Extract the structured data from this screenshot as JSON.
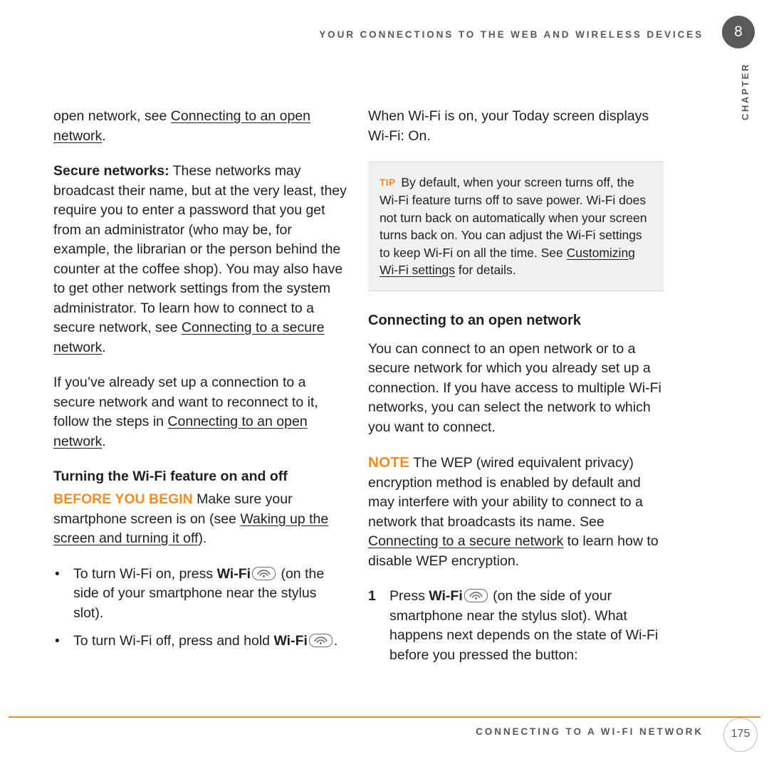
{
  "header": {
    "title": "YOUR CONNECTIONS TO THE WEB AND WIRELESS DEVICES",
    "chapter_number": "8",
    "chapter_label": "CHAPTER"
  },
  "footer": {
    "title": "CONNECTING TO A WI-FI NETWORK",
    "page_number": "175",
    "accent_color": "#f68b1f"
  },
  "left_column": {
    "para_continue_1": "open network, see ",
    "para_continue_1_link": "Connecting to an open network",
    "para_continue_1_end": ".",
    "secure_label": "Secure networks:",
    "secure_body": " These networks may broadcast their name, but at the very least, they require you to enter a password that you get from an administrator (who may be, for example, the librarian or the person behind the counter at the coffee shop). You may also have to get other network settings from the system administrator. To learn how to connect to a secure network, see ",
    "secure_link": "Connecting to a secure network",
    "secure_end": ".",
    "para_reconnect_start": "If you’ve already set up a connection to a secure network and want to reconnect to it, follow the steps in ",
    "para_reconnect_link": "Connecting to an open network",
    "para_reconnect_end": ".",
    "subhead_turning": "Turning the Wi-Fi feature on and off",
    "before_you_begin_label": "BEFORE YOU BEGIN",
    "before_you_begin_body": "  Make sure your smartphone screen is on (see ",
    "before_you_begin_link": "Waking up the screen and turning it off",
    "before_you_begin_end": ").",
    "bullets": [
      {
        "marker": "•",
        "text_before": "To turn Wi-Fi on, press ",
        "bold": "Wi-Fi",
        "icon": "wifi-key-icon",
        "text_after": " (on the side of your smartphone near the stylus slot)."
      },
      {
        "marker": "•",
        "text_before": "To turn Wi-Fi off, press and hold ",
        "bold": "Wi-Fi",
        "icon": "wifi-key-icon",
        "text_after": "."
      }
    ]
  },
  "right_column": {
    "para_today_screen": "When Wi-Fi is on, your Today screen displays Wi-Fi: On.",
    "tip": {
      "label": "TIP",
      "body_before": " By default, when your screen turns off, the Wi-Fi feature turns off to save power. Wi-Fi does not turn back on automatically when your screen turns back on. You can adjust the Wi-Fi settings to keep Wi-Fi on all the time. See ",
      "link": "Customizing Wi-Fi settings",
      "body_after": " for details."
    },
    "section_head": "Connecting to an open network",
    "para_connect": "You can connect to an open network or to a secure network for which you already set up a connection. If you have access to multiple Wi-Fi networks, you can select the network to which you want to connect.",
    "note_label": "NOTE",
    "note_body_before": "  The WEP (wired equivalent privacy) encryption method is enabled by default and may interfere with your ability to connect to a network that broadcasts its name. See ",
    "note_link": "Connecting to a secure network",
    "note_body_after": " to learn how to disable WEP encryption.",
    "steps": [
      {
        "number": "1",
        "text_before": "Press ",
        "bold": "Wi-Fi",
        "icon": "wifi-key-icon",
        "text_after": " (on the side of your smartphone near the stylus slot). What happens next depends on the state of Wi-Fi before you pressed the button:"
      }
    ]
  }
}
